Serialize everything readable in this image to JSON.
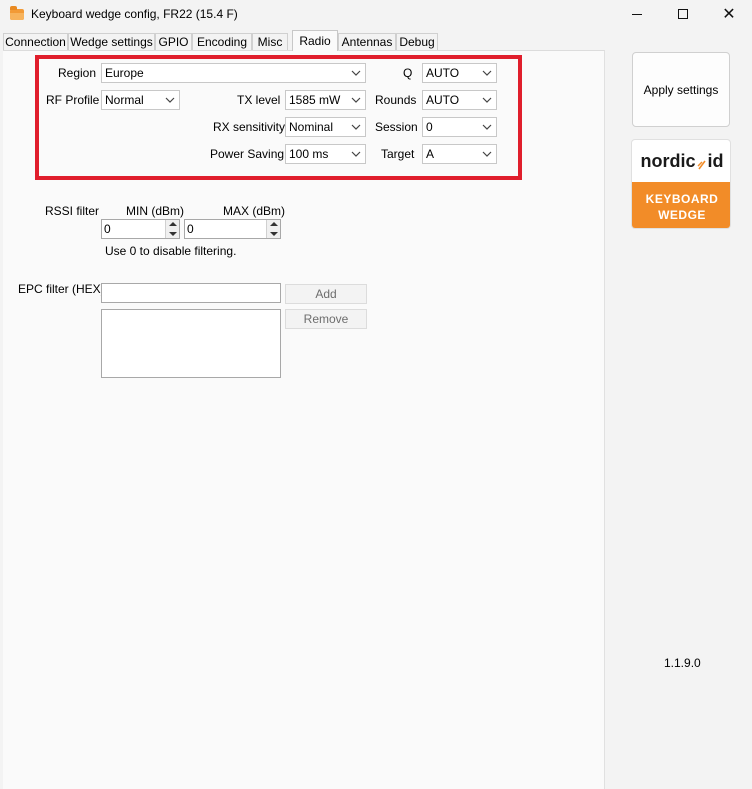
{
  "window": {
    "title": "Keyboard wedge config, FR22  (15.4 F)",
    "minimize_glyph": "",
    "maximize_glyph": "",
    "close_glyph": "✕"
  },
  "tabs": [
    {
      "label": "Connection",
      "active": false
    },
    {
      "label": "Wedge settings",
      "active": false
    },
    {
      "label": "GPIO",
      "active": false
    },
    {
      "label": "Encoding",
      "active": false
    },
    {
      "label": "Misc",
      "active": false
    },
    {
      "label": "Radio",
      "active": true
    },
    {
      "label": "Antennas",
      "active": false
    },
    {
      "label": "Debug",
      "active": false
    }
  ],
  "radio": {
    "region_label": "Region",
    "region_value": "Europe",
    "rf_profile_label": "RF Profile",
    "rf_profile_value": "Normal",
    "tx_level_label": "TX level",
    "tx_level_value": "1585 mW",
    "rx_sensitivity_label": "RX sensitivity",
    "rx_sensitivity_value": "Nominal",
    "power_saving_label": "Power Saving",
    "power_saving_value": "100 ms",
    "q_label": "Q",
    "q_value": "AUTO",
    "rounds_label": "Rounds",
    "rounds_value": "AUTO",
    "session_label": "Session",
    "session_value": "0",
    "target_label": "Target",
    "target_value": "A"
  },
  "rssi": {
    "label": "RSSI filter",
    "min_label": "MIN (dBm)",
    "max_label": "MAX (dBm)",
    "min_value": "0",
    "max_value": "0",
    "hint": "Use 0 to disable filtering."
  },
  "epc": {
    "label": "EPC filter (HEX)",
    "input_value": "",
    "add_label": "Add",
    "remove_label": "Remove"
  },
  "sidebar": {
    "apply_label": "Apply settings",
    "logo_brand": "nordic",
    "logo_brand_suffix": "id",
    "logo_line1": "KEYBOARD",
    "logo_line2": "WEDGE",
    "version": "1.1.9.0"
  },
  "colors": {
    "highlight_border": "#e01e2c",
    "logo_orange": "#f28c28"
  }
}
